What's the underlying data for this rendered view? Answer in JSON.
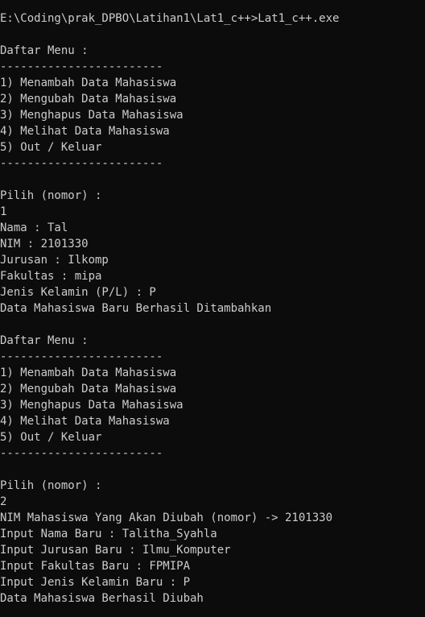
{
  "console": {
    "lines": [
      "E:\\Coding\\prak_DPBO\\Latihan1\\Lat1_c++>Lat1_c++.exe",
      "",
      "Daftar Menu :",
      "------------------------",
      "1) Menambah Data Mahasiswa",
      "2) Mengubah Data Mahasiswa",
      "3) Menghapus Data Mahasiswa",
      "4) Melihat Data Mahasiswa",
      "5) Out / Keluar",
      "------------------------",
      "",
      "Pilih (nomor) :",
      "1",
      "Nama : Tal",
      "NIM : 2101330",
      "Jurusan : Ilkomp",
      "Fakultas : mipa",
      "Jenis Kelamin (P/L) : P",
      "Data Mahasiswa Baru Berhasil Ditambahkan",
      "",
      "Daftar Menu :",
      "------------------------",
      "1) Menambah Data Mahasiswa",
      "2) Mengubah Data Mahasiswa",
      "3) Menghapus Data Mahasiswa",
      "4) Melihat Data Mahasiswa",
      "5) Out / Keluar",
      "------------------------",
      "",
      "Pilih (nomor) :",
      "2",
      "NIM Mahasiswa Yang Akan Diubah (nomor) -> 2101330",
      "Input Nama Baru : Talitha_Syahla",
      "Input Jurusan Baru : Ilmu_Komputer",
      "Input Fakultas Baru : FPMIPA",
      "Input Jenis Kelamin Baru : P",
      "Data Mahasiswa Berhasil Diubah"
    ]
  },
  "colors": {
    "background": "#0c0c0c",
    "foreground": "#cccccc"
  }
}
